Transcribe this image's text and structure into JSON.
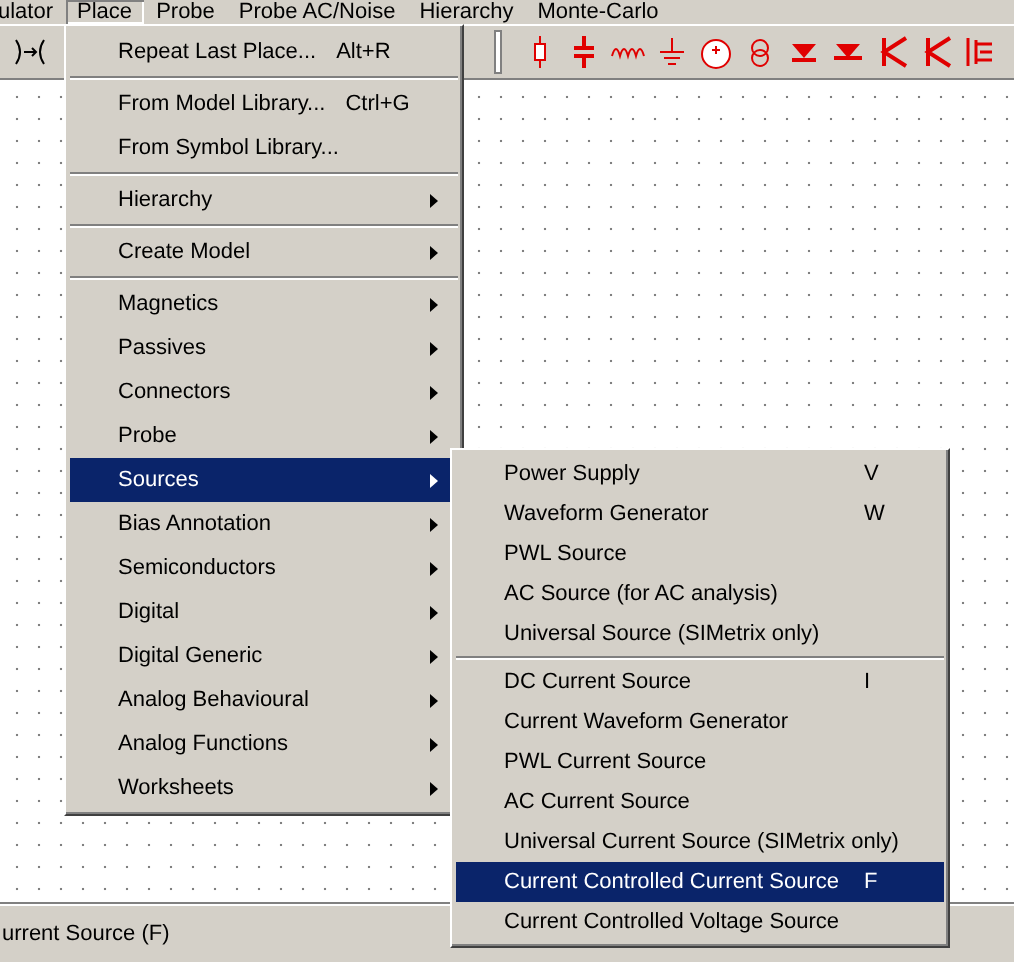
{
  "menubar": [
    {
      "label": "ulator",
      "selected": false
    },
    {
      "label": "Place",
      "selected": true
    },
    {
      "label": "Probe",
      "selected": false
    },
    {
      "label": "Probe AC/Noise",
      "selected": false
    },
    {
      "label": "Hierarchy",
      "selected": false
    },
    {
      "label": "Monte-Carlo",
      "selected": false
    }
  ],
  "place_menu": {
    "groups": [
      [
        {
          "label": "Repeat Last Place...",
          "shortcut": "Alt+R",
          "submenu": false,
          "selected": false
        }
      ],
      [
        {
          "label": "From Model Library...",
          "shortcut": "Ctrl+G",
          "submenu": false,
          "selected": false
        },
        {
          "label": "From Symbol Library...",
          "submenu": false,
          "selected": false
        }
      ],
      [
        {
          "label": "Hierarchy",
          "submenu": true,
          "selected": false
        }
      ],
      [
        {
          "label": "Create Model",
          "submenu": true,
          "selected": false
        }
      ],
      [
        {
          "label": "Magnetics",
          "submenu": true,
          "selected": false
        },
        {
          "label": "Passives",
          "submenu": true,
          "selected": false
        },
        {
          "label": "Connectors",
          "submenu": true,
          "selected": false
        },
        {
          "label": "Probe",
          "submenu": true,
          "selected": false
        },
        {
          "label": "Sources",
          "submenu": true,
          "selected": true
        },
        {
          "label": "Bias Annotation",
          "submenu": true,
          "selected": false
        },
        {
          "label": "Semiconductors",
          "submenu": true,
          "selected": false
        },
        {
          "label": "Digital",
          "submenu": true,
          "selected": false
        },
        {
          "label": "Digital Generic",
          "submenu": true,
          "selected": false
        },
        {
          "label": "Analog Behavioural",
          "submenu": true,
          "selected": false
        },
        {
          "label": "Analog Functions",
          "submenu": true,
          "selected": false
        },
        {
          "label": "Worksheets",
          "submenu": true,
          "selected": false
        }
      ]
    ]
  },
  "sources_menu": {
    "groups": [
      [
        {
          "label": "Power Supply",
          "shortcut": "V",
          "submenu": false,
          "selected": false
        },
        {
          "label": "Waveform Generator",
          "shortcut": "W",
          "submenu": false,
          "selected": false
        },
        {
          "label": "PWL Source",
          "submenu": false,
          "selected": false
        },
        {
          "label": "AC Source (for AC analysis)",
          "submenu": false,
          "selected": false
        },
        {
          "label": "Universal Source (SIMetrix only)",
          "submenu": false,
          "selected": false
        }
      ],
      [
        {
          "label": "DC Current Source",
          "shortcut": "I",
          "submenu": false,
          "selected": false
        },
        {
          "label": "Current Waveform Generator",
          "submenu": false,
          "selected": false
        },
        {
          "label": "PWL Current Source",
          "submenu": false,
          "selected": false
        },
        {
          "label": "AC Current Source",
          "submenu": false,
          "selected": false
        },
        {
          "label": "Universal Current Source (SIMetrix only)",
          "submenu": false,
          "selected": false
        },
        {
          "label": "Current Controlled Current Source",
          "shortcut": "F",
          "submenu": false,
          "selected": true
        },
        {
          "label": "Current Controlled Voltage Source",
          "submenu": false,
          "selected": false
        }
      ]
    ]
  },
  "status_bar": {
    "text": "urrent Source (F)"
  }
}
